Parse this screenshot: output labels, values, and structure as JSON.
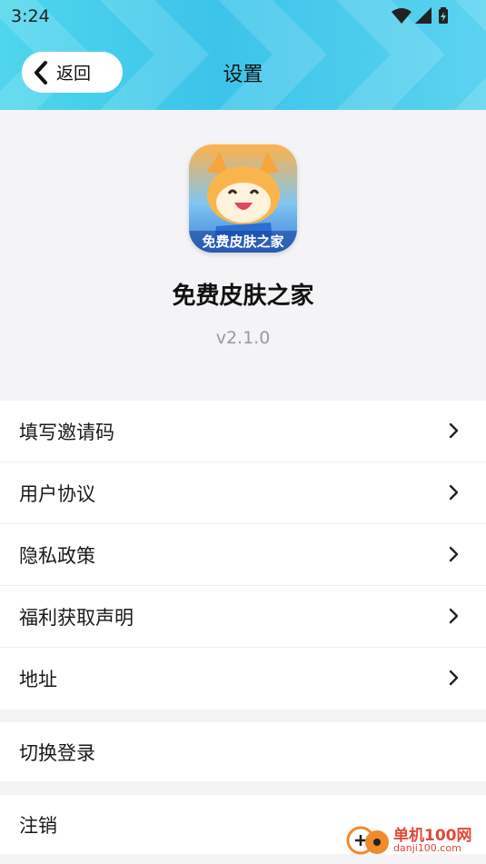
{
  "status_bar": {
    "time": "3:24"
  },
  "header": {
    "back_label": "返回",
    "title": "设置"
  },
  "app": {
    "icon_text": "免费皮肤之家",
    "name": "免费皮肤之家",
    "version": "v2.1.0"
  },
  "menu_main": [
    {
      "label": "填写邀请码"
    },
    {
      "label": "用户协议"
    },
    {
      "label": "隐私政策"
    },
    {
      "label": "福利获取声明"
    },
    {
      "label": "地址"
    }
  ],
  "menu_switch": {
    "label": "切换登录"
  },
  "menu_cancel": {
    "label": "注销"
  },
  "watermark": {
    "cn": "单机100网",
    "url": "danji100.com"
  },
  "colors": {
    "header": "#3bc4ea",
    "background": "#f4f4f6",
    "watermark": "#e1483a"
  }
}
